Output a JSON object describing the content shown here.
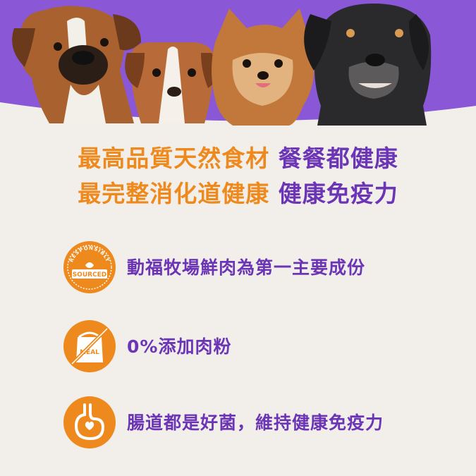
{
  "hero": {
    "image_label": "four-dogs-photo",
    "dogs": [
      "boxer-dog",
      "puppy-dog",
      "pomeranian-dog",
      "senior-black-dog"
    ]
  },
  "headline": {
    "line1_orange": "最高品質天然食材",
    "line1_purple": "餐餐都健康",
    "line2_orange": "最完整消化道健康",
    "line2_purple": "健康免疫力"
  },
  "features": [
    {
      "icon": "responsibly-sourced-badge-icon",
      "badge_arc_text": "RESPONSIBLY",
      "badge_text": "SOURCED",
      "text": "動福牧場鮮肉為第一主要成份"
    },
    {
      "icon": "no-meal-bag-icon",
      "badge_text": "MEAL",
      "text": "0%添加肉粉"
    },
    {
      "icon": "stomach-heart-icon",
      "text": "腸道都是好菌，維持健康免疫力"
    }
  ],
  "colors": {
    "purple": "#6b35b5",
    "banner_purple": "#8a57d6",
    "orange": "#ee8a1d",
    "background": "#f2eee9"
  }
}
